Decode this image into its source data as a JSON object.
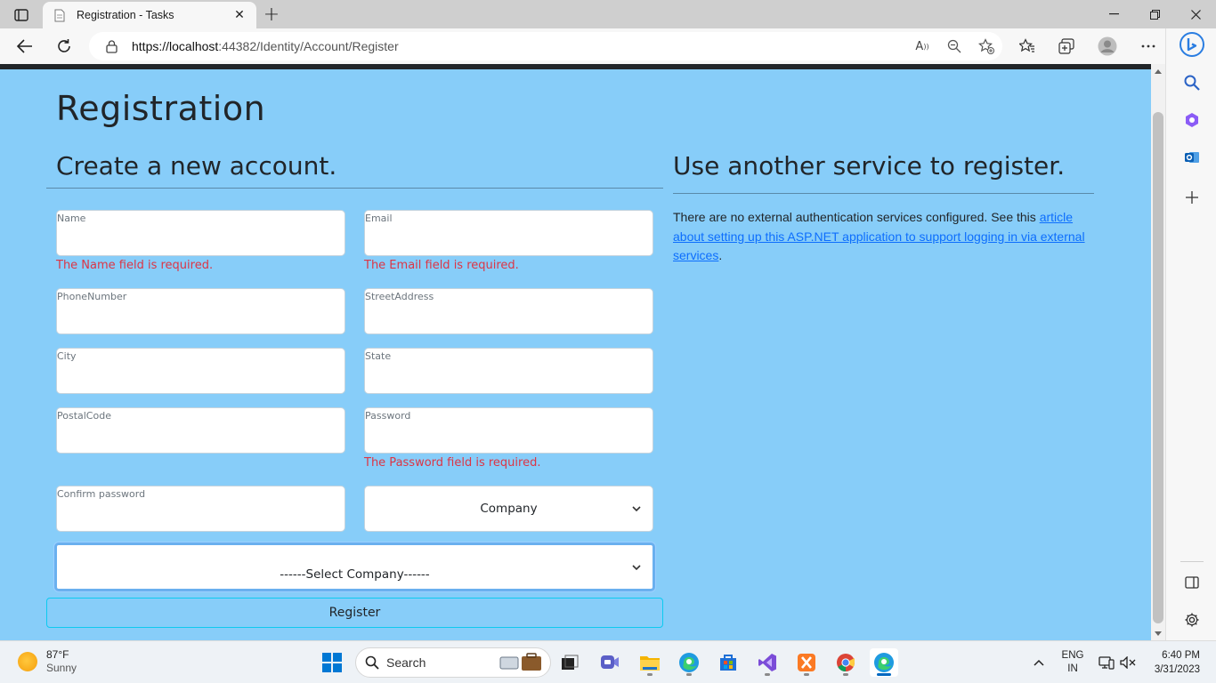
{
  "browser": {
    "tab_title": "Registration - Tasks",
    "url_host": "https://localhost",
    "url_rest": ":44382/Identity/Account/Register"
  },
  "page": {
    "heading": "Registration",
    "left_heading": "Create a new account.",
    "right_heading": "Use another service to register.",
    "ext_text_before": "There are no external authentication services configured. See this ",
    "ext_link": "article about setting up this ASP.NET application to support logging in via external services",
    "ext_text_after": "."
  },
  "form": {
    "fields": {
      "name": {
        "label": "Name",
        "error": "The Name field is required."
      },
      "email": {
        "label": "Email",
        "error": "The Email field is required."
      },
      "phone": {
        "label": "PhoneNumber"
      },
      "street": {
        "label": "StreetAddress"
      },
      "city": {
        "label": "City"
      },
      "state": {
        "label": "State"
      },
      "postal": {
        "label": "PostalCode"
      },
      "password": {
        "label": "Password",
        "error": "The Password field is required."
      },
      "confirm": {
        "label": "Confirm password"
      }
    },
    "role_select": "Company",
    "company_select": "------Select Company------",
    "register_label": "Register"
  },
  "taskbar": {
    "weather_temp": "87°F",
    "weather_cond": "Sunny",
    "search_label": "Search",
    "lang_line1": "ENG",
    "lang_line2": "IN",
    "time": "6:40 PM",
    "date": "3/31/2023"
  },
  "colors": {
    "page_background": "#87cdf9",
    "error": "#dc3545",
    "link": "#0d6efd",
    "register_border": "#0dcaf0"
  }
}
